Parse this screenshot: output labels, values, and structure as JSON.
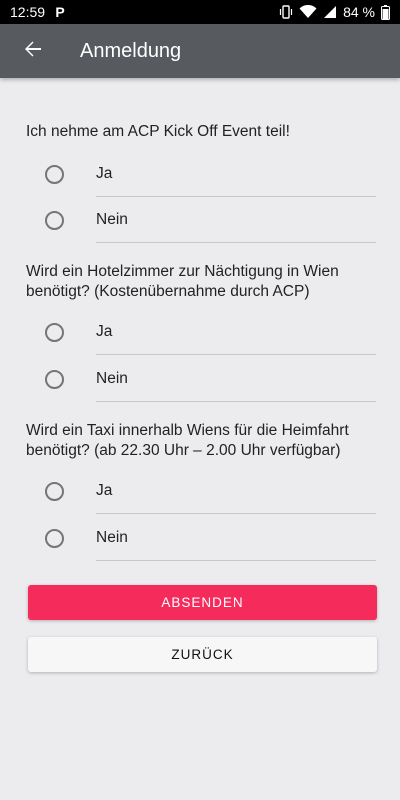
{
  "status_bar": {
    "time": "12:59",
    "app_icon": "P",
    "battery": "84 %",
    "icons": [
      "vibrate-icon",
      "wifi-icon",
      "signal-icon",
      "battery-icon"
    ]
  },
  "app_bar": {
    "title": "Anmeldung",
    "back_icon": "arrow-back-icon",
    "color": "#575b60"
  },
  "questions": [
    {
      "text": "Ich nehme am ACP Kick Off Event teil!",
      "options": [
        "Ja",
        "Nein"
      ]
    },
    {
      "text": "Wird ein Hotelzimmer zur Nächtigung in Wien benötigt? (Kostenübernahme durch ACP)",
      "options": [
        "Ja",
        "Nein"
      ]
    },
    {
      "text": "Wird ein Taxi innerhalb Wiens für die Heimfahrt benötigt? (ab 22.30 Uhr – 2.00 Uhr verfügbar)",
      "options": [
        "Ja",
        "Nein"
      ]
    }
  ],
  "buttons": {
    "submit": "ABSENDEN",
    "back": "ZURÜCK"
  },
  "colors": {
    "accent": "#f42b5b",
    "background": "#ececef"
  }
}
